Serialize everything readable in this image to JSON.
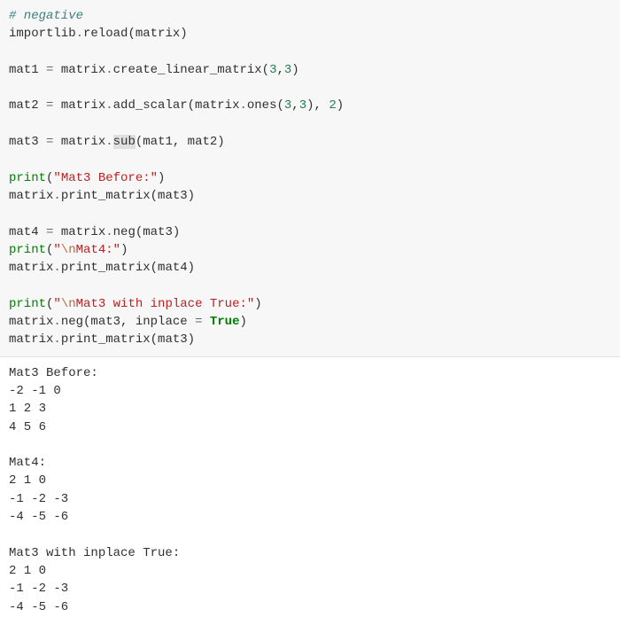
{
  "code": {
    "l01": "# negative",
    "l02a": "importlib",
    "l02b": ".",
    "l02c": "reload(matrix)",
    "l03a": "mat1 ",
    "l03b": "=",
    "l03c": " matrix",
    "l03d": ".",
    "l03e": "create_linear_matrix(",
    "l03f": "3",
    "l03g": ",",
    "l03h": "3",
    "l03i": ")",
    "l04a": "mat2 ",
    "l04b": "=",
    "l04c": " matrix",
    "l04d": ".",
    "l04e": "add_scalar(matrix",
    "l04f": ".",
    "l04g": "ones(",
    "l04h": "3",
    "l04i": ",",
    "l04j": "3",
    "l04k": "), ",
    "l04l": "2",
    "l04m": ")",
    "l05a": "mat3 ",
    "l05b": "=",
    "l05c": " matrix",
    "l05d": ".",
    "l05e": "sub",
    "l05f": "(mat1, mat2)",
    "l06a": "print",
    "l06b": "(",
    "l06c": "\"Mat3 Before:\"",
    "l06d": ")",
    "l07a": "matrix",
    "l07b": ".",
    "l07c": "print_matrix(mat3)",
    "l08a": "mat4 ",
    "l08b": "=",
    "l08c": " matrix",
    "l08d": ".",
    "l08e": "neg(mat3)",
    "l09a": "print",
    "l09b": "(",
    "l09c": "\"",
    "l09c2": "\\n",
    "l09c3": "Mat4:\"",
    "l09d": ")",
    "l10a": "matrix",
    "l10b": ".",
    "l10c": "print_matrix(mat4)",
    "l11a": "print",
    "l11b": "(",
    "l11c": "\"",
    "l11c2": "\\n",
    "l11c3": "Mat3 with inplace True:\"",
    "l11d": ")",
    "l12a": "matrix",
    "l12b": ".",
    "l12c": "neg(mat3, inplace ",
    "l12d": "=",
    "l12e": " ",
    "l12f": "True",
    "l12g": ")",
    "l13a": "matrix",
    "l13b": ".",
    "l13c": "print_matrix(mat3)"
  },
  "output": {
    "block1header": "Mat3 Before:",
    "block1row1": "-2 -1 0",
    "block1row2": "1 2 3",
    "block1row3": "4 5 6",
    "block2header": "Mat4:",
    "block2row1": "2 1 0",
    "block2row2": "-1 -2 -3",
    "block2row3": "-4 -5 -6",
    "block3header": "Mat3 with inplace True:",
    "block3row1": "2 1 0",
    "block3row2": "-1 -2 -3",
    "block3row3": "-4 -5 -6"
  }
}
